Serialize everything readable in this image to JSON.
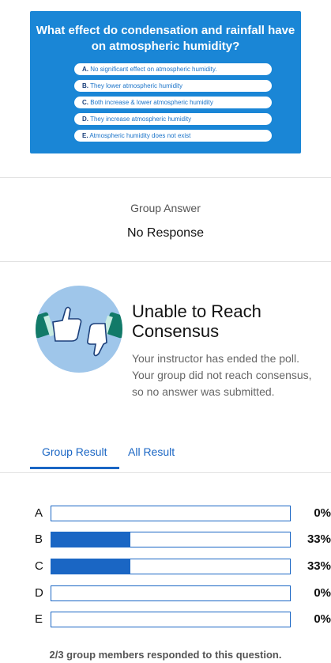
{
  "question": {
    "title": "What effect do condensation and rainfall have\non atmospheric humidity?",
    "options": [
      {
        "letter": "A.",
        "text": "No significant effect on atmospheric humidity."
      },
      {
        "letter": "B.",
        "text": "They lower atmospheric humidity"
      },
      {
        "letter": "C.",
        "text": "Both increase & lower atmospheric humidity"
      },
      {
        "letter": "D.",
        "text": "They increase atmospheric humidity"
      },
      {
        "letter": "E.",
        "text": "Atmospheric humidity does not exist"
      }
    ]
  },
  "group_answer": {
    "label": "Group Answer",
    "value": "No Response"
  },
  "consensus": {
    "title": "Unable to Reach\nConsensus",
    "message": "Your instructor has ended the poll. Your group did not reach consensus, so no answer was submitted."
  },
  "tabs": [
    {
      "label": "Group Result",
      "active": true
    },
    {
      "label": "All Result",
      "active": false
    }
  ],
  "results": [
    {
      "label": "A",
      "pct_text": "0%",
      "value": 0
    },
    {
      "label": "B",
      "pct_text": "33%",
      "value": 33
    },
    {
      "label": "C",
      "pct_text": "33%",
      "value": 33
    },
    {
      "label": "D",
      "pct_text": "0%",
      "value": 0
    },
    {
      "label": "E",
      "pct_text": "0%",
      "value": 0
    }
  ],
  "footer": {
    "note": "2/3 group members responded to this question."
  },
  "colors": {
    "card_bg": "#1a86d6",
    "accent": "#1a66c4"
  }
}
